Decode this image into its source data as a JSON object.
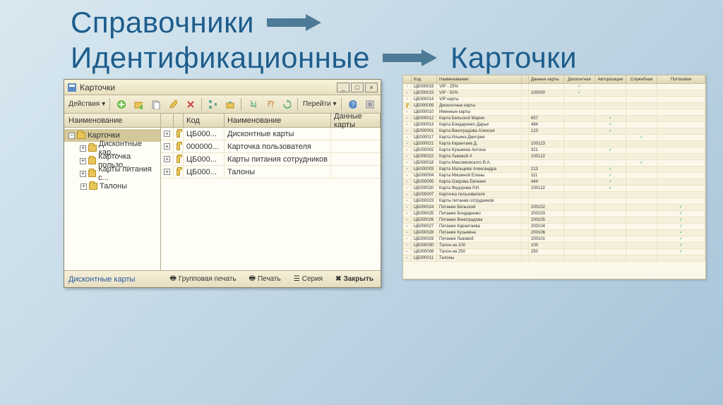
{
  "slide": {
    "line1": "Справочники",
    "line2": "Идентификационные",
    "line3": "Карточки"
  },
  "window": {
    "title": "Карточки",
    "toolbar": {
      "actions": "Действия",
      "goto": "Перейти"
    },
    "tree": {
      "header": "Наименование",
      "root": "Карточки",
      "items": [
        "Дисконтные кар...",
        "Карточка пользо...",
        "Карты питания с...",
        "Талоны"
      ]
    },
    "grid": {
      "headers": {
        "code": "Код",
        "name": "Наименование",
        "data": "Данные карты"
      },
      "rows": [
        {
          "code": "ЦБ000...",
          "name": "Дисконтные карты"
        },
        {
          "code": "000000...",
          "name": "Карточка пользователя"
        },
        {
          "code": "ЦБ000...",
          "name": "Карты питания сотрудников"
        },
        {
          "code": "ЦБ000...",
          "name": "Талоны"
        }
      ]
    },
    "status": {
      "link": "Дисконтные карты",
      "group_print": "Групповая печать",
      "print": "Печать",
      "series": "Серия",
      "close": "Закрыть"
    }
  },
  "bigtable": {
    "headers": [
      "",
      "Код",
      "Наименование",
      "",
      "Данные карты",
      "Дисконтная",
      "Авторизация",
      "Служебная",
      "Потоковая"
    ],
    "rows": [
      {
        "code": "ЦБ000019",
        "name": "VIP - 25%",
        "data": "",
        "disc": true,
        "auth": false,
        "srv": false,
        "flow": false
      },
      {
        "code": "ЦБ000015",
        "name": "VIP - 50%",
        "data": "100000",
        "disc": true,
        "auth": false,
        "srv": false,
        "flow": false
      },
      {
        "code": "ЦБ000014",
        "name": "VIP карты",
        "data": "",
        "disc": false,
        "auth": false,
        "srv": false,
        "flow": false
      },
      {
        "code": "ЦБ000009",
        "name": "Дисконтные карты",
        "data": "",
        "disc": false,
        "auth": false,
        "srv": false,
        "flow": false,
        "folder": true
      },
      {
        "code": "ЦБ000010",
        "name": "Именные карты",
        "data": "",
        "disc": false,
        "auth": false,
        "srv": false,
        "flow": false
      },
      {
        "code": "ЦБ000012",
        "name": "Карта Бельской Марии",
        "data": "657",
        "disc": false,
        "auth": true,
        "srv": false,
        "flow": false
      },
      {
        "code": "ЦБ000013",
        "name": "Карта Бондаренко Дарьи",
        "data": "484",
        "disc": false,
        "auth": true,
        "srv": false,
        "flow": false
      },
      {
        "code": "ЦБ000001",
        "name": "Карта Виноградова Алексея",
        "data": "123",
        "disc": false,
        "auth": true,
        "srv": false,
        "flow": false
      },
      {
        "code": "ЦБ000017",
        "name": "Карта Ильина Дмитрия",
        "data": "",
        "disc": false,
        "auth": false,
        "srv": true,
        "flow": false
      },
      {
        "code": "ЦБ000021",
        "name": "Карта Карантаев Д.",
        "data": "100123",
        "disc": false,
        "auth": false,
        "srv": false,
        "flow": false
      },
      {
        "code": "ЦБ000002",
        "name": "Карта Кузьмина Антона",
        "data": "321",
        "disc": false,
        "auth": true,
        "srv": false,
        "flow": false
      },
      {
        "code": "ЦБ000022",
        "name": "Карта Львовой А",
        "data": "100122",
        "disc": false,
        "auth": false,
        "srv": false,
        "flow": false
      },
      {
        "code": "ЦБ000018",
        "name": "Карта Максимовского В.А.",
        "data": "",
        "disc": false,
        "auth": false,
        "srv": true,
        "flow": false
      },
      {
        "code": "ЦБ000003",
        "name": "Карта Мальцева Александра",
        "data": "213",
        "disc": false,
        "auth": true,
        "srv": false,
        "flow": false
      },
      {
        "code": "ЦБ000004",
        "name": "Карта Мишиной Елены",
        "data": "111",
        "disc": false,
        "auth": true,
        "srv": false,
        "flow": false
      },
      {
        "code": "ЦБ000005",
        "name": "Карта Озерова Евгения",
        "data": "444",
        "disc": false,
        "auth": true,
        "srv": false,
        "flow": false
      },
      {
        "code": "ЦБ000020",
        "name": "Карта Федорова Р.И.",
        "data": "100122",
        "disc": false,
        "auth": true,
        "srv": false,
        "flow": false
      },
      {
        "code": "ЦБ000007",
        "name": "Карточка пользователя",
        "data": "",
        "disc": false,
        "auth": false,
        "srv": false,
        "flow": false
      },
      {
        "code": "ЦБ000023",
        "name": "Карты питания сотрудников",
        "data": "",
        "disc": false,
        "auth": false,
        "srv": false,
        "flow": false
      },
      {
        "code": "ЦБ000024",
        "name": "Питание Бельской",
        "data": "200102",
        "disc": false,
        "auth": false,
        "srv": false,
        "flow": true
      },
      {
        "code": "ЦБ000025",
        "name": "Питание Бондаренко",
        "data": "200103",
        "disc": false,
        "auth": false,
        "srv": false,
        "flow": true
      },
      {
        "code": "ЦБ000026",
        "name": "Питание Виноградова",
        "data": "200105",
        "disc": false,
        "auth": false,
        "srv": false,
        "flow": true
      },
      {
        "code": "ЦБ000027",
        "name": "Питание Карантаева",
        "data": "200104",
        "disc": false,
        "auth": false,
        "srv": false,
        "flow": true
      },
      {
        "code": "ЦБ000028",
        "name": "Питание Кузьмина",
        "data": "200106",
        "disc": false,
        "auth": false,
        "srv": false,
        "flow": true
      },
      {
        "code": "ЦБ000029",
        "name": "Питание Львовой",
        "data": "200101",
        "disc": false,
        "auth": false,
        "srv": false,
        "flow": true
      },
      {
        "code": "ЦБ000030",
        "name": "Талон на 100",
        "data": "100",
        "disc": false,
        "auth": false,
        "srv": false,
        "flow": true
      },
      {
        "code": "ЦБ000008",
        "name": "Талон на 250",
        "data": "250",
        "disc": false,
        "auth": false,
        "srv": false,
        "flow": true
      },
      {
        "code": "ЦБ000011",
        "name": "Талоны",
        "data": "",
        "disc": false,
        "auth": false,
        "srv": false,
        "flow": false
      }
    ]
  }
}
